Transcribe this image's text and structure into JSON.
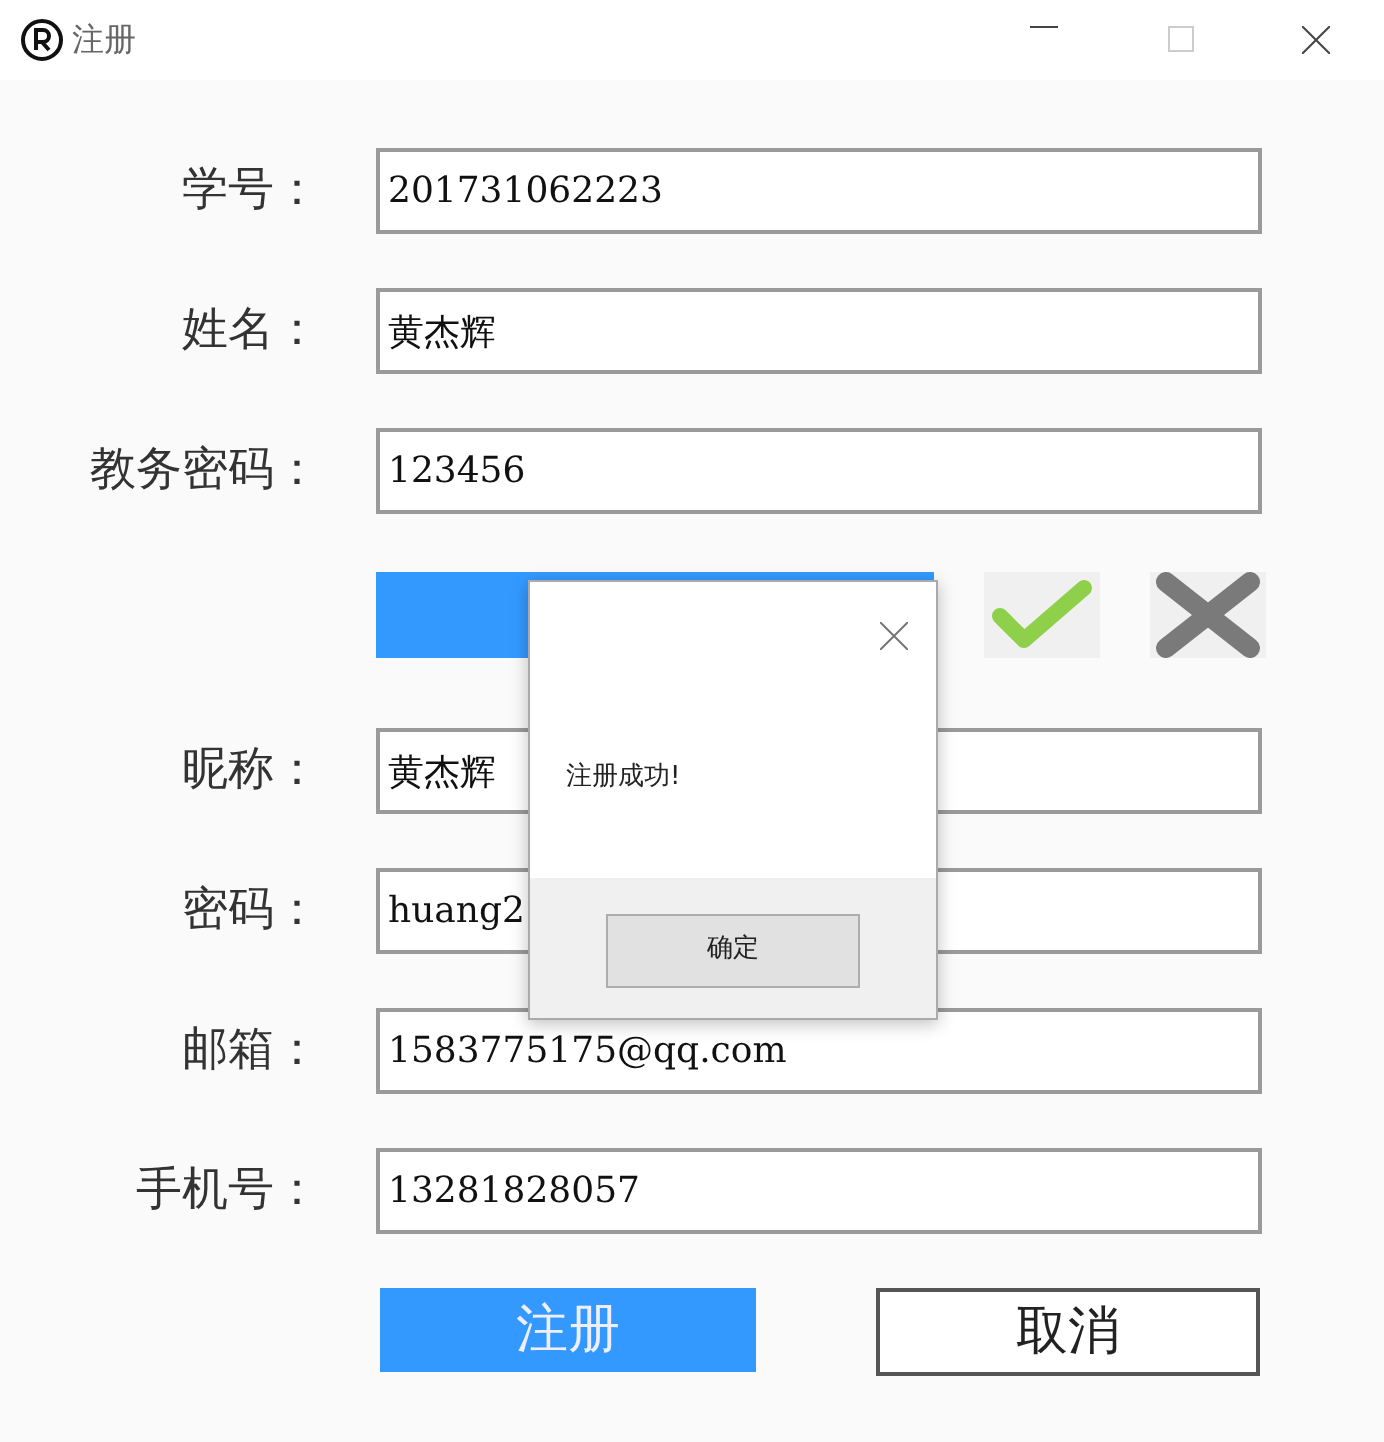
{
  "window": {
    "title": "注册"
  },
  "rows": [
    {
      "kind": "field",
      "label": "学号：",
      "value": "201731062223"
    },
    {
      "kind": "field",
      "label": "姓名：",
      "value": "黄杰辉"
    },
    {
      "kind": "field",
      "label": "教务密码：",
      "value": "123456"
    },
    {
      "kind": "verify"
    },
    {
      "kind": "field",
      "label": "昵称：",
      "value": "黄杰辉"
    },
    {
      "kind": "field",
      "label": "密码：",
      "value": "huang2"
    },
    {
      "kind": "field",
      "label": "邮箱：",
      "value": "1583775175@qq.com"
    },
    {
      "kind": "field",
      "label": "手机号：",
      "value": "13281828057"
    }
  ],
  "buttons": [
    {
      "kind": "primary",
      "label": "注册"
    },
    {
      "kind": "outline",
      "label": "取消"
    }
  ],
  "dialog": {
    "message": "注册成功!",
    "button": "确定"
  }
}
